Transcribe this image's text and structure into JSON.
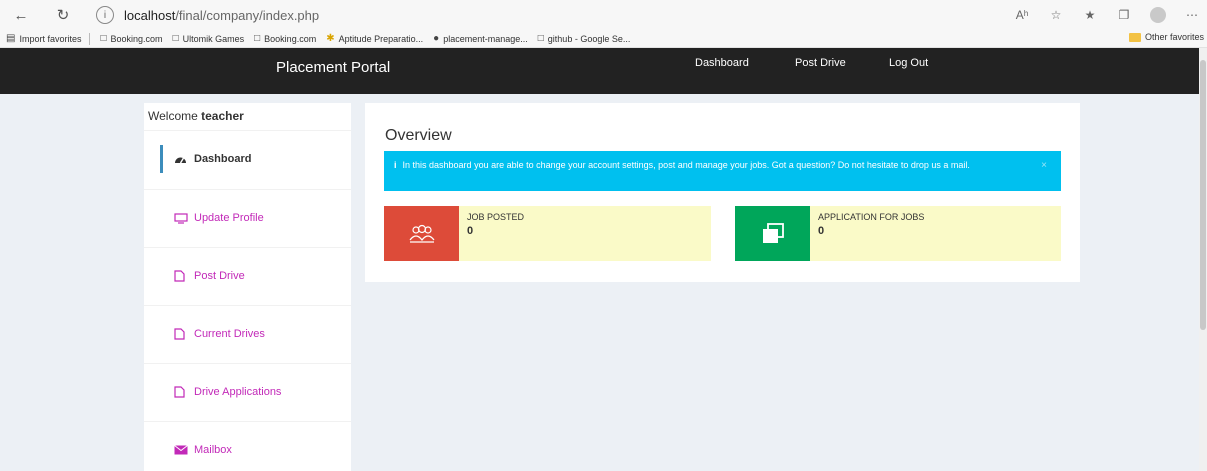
{
  "browser": {
    "url_host": "localhost",
    "url_path": "/final/company/index.php",
    "read_aloud": "Aʰ",
    "favorites": [
      {
        "label": "Import favorites",
        "icon": "import-icon"
      },
      {
        "label": "Booking.com",
        "icon": "page-icon"
      },
      {
        "label": "Ultomik Games",
        "icon": "page-icon"
      },
      {
        "label": "Booking.com",
        "icon": "page-icon"
      },
      {
        "label": "Aptitude Preparatio...",
        "icon": "star-icon"
      },
      {
        "label": "placement-manage...",
        "icon": "github-icon"
      },
      {
        "label": "github - Google Se...",
        "icon": "page-icon"
      }
    ],
    "other_favorites": "Other favorites"
  },
  "nav": {
    "brand": "Placement Portal",
    "links": [
      "Dashboard",
      "Post Drive",
      "Log Out"
    ]
  },
  "sidebar": {
    "welcome_prefix": "Welcome",
    "username": "teacher",
    "items": [
      {
        "label": "Dashboard",
        "icon": "dashboard-icon",
        "active": true
      },
      {
        "label": "Update Profile",
        "icon": "monitor-icon",
        "active": false
      },
      {
        "label": "Post Drive",
        "icon": "document-icon",
        "active": false
      },
      {
        "label": "Current Drives",
        "icon": "document-icon",
        "active": false
      },
      {
        "label": "Drive Applications",
        "icon": "document-icon",
        "active": false
      },
      {
        "label": "Mailbox",
        "icon": "envelope-icon",
        "active": false
      }
    ]
  },
  "main": {
    "title": "Overview",
    "alert_icon": "i",
    "alert_text": "In this dashboard you are able to change your account settings, post and manage your jobs. Got a question? Do not hesitate to drop us a mail.",
    "alert_close": "×",
    "stats": [
      {
        "label": "JOB POSTED",
        "value": "0",
        "icon": "users-icon",
        "color": "#dd4b39"
      },
      {
        "label": "APPLICATION FOR JOBS",
        "value": "0",
        "icon": "copy-icon",
        "color": "#00a65a"
      }
    ]
  },
  "colors": {
    "nav_bg": "#222222",
    "page_bg": "#ecf0f5",
    "link": "#c229b8",
    "alert": "#00c0ef",
    "stat_bg": "#fafac8"
  }
}
